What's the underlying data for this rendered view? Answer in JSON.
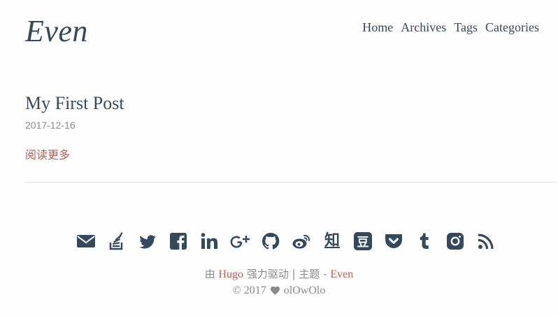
{
  "header": {
    "logo": "Even",
    "nav": [
      "Home",
      "Archives",
      "Tags",
      "Categories"
    ]
  },
  "post": {
    "title": "My First Post",
    "date": "2017-12-16",
    "read_more": "阅读更多"
  },
  "footer": {
    "social_icons": [
      "email-icon",
      "stack-overflow-icon",
      "twitter-icon",
      "facebook-icon",
      "linkedin-icon",
      "google-plus-icon",
      "github-icon",
      "weibo-icon",
      "zhihu-icon",
      "douban-icon",
      "pocket-icon",
      "tumblr-icon",
      "instagram-icon",
      "rss-icon"
    ],
    "zhihu_glyph": "知",
    "douban_glyph": "豆",
    "powered_prefix": "由",
    "powered_link": "Hugo",
    "powered_middle": "强力驱动 | 主题 -",
    "theme_link": "Even",
    "copyright_year": "© 2017",
    "author": "olOwOlo"
  },
  "colors": {
    "text": "#34495e",
    "accent": "#c05b4d",
    "muted": "#8a8a8a",
    "divider": "#e2e2e2"
  }
}
